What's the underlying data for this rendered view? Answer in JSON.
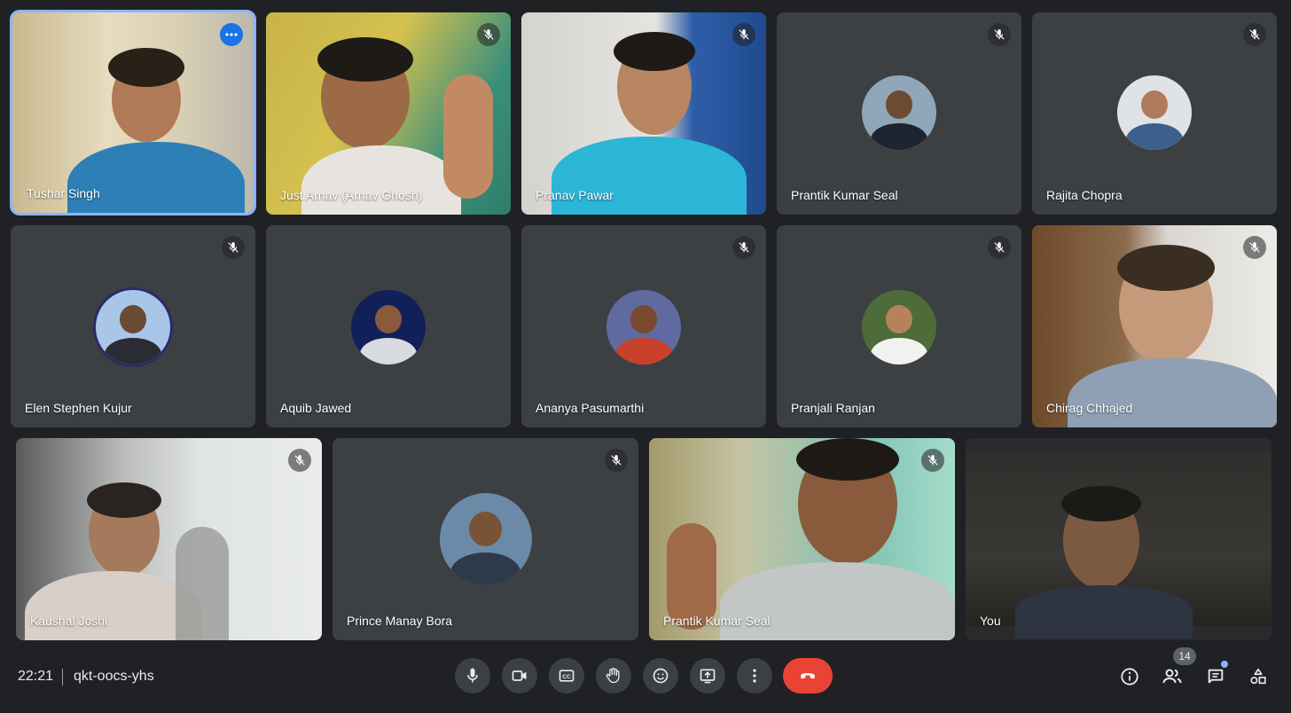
{
  "participants": [
    {
      "name": "Tushar Singh"
    },
    {
      "name": "Just Arnav (Arnav Ghosh)"
    },
    {
      "name": "Pranav Pawar"
    },
    {
      "name": "Prantik Kumar Seal"
    },
    {
      "name": "Rajita Chopra"
    },
    {
      "name": "Elen Stephen Kujur"
    },
    {
      "name": "Aquib Jawed"
    },
    {
      "name": "Ananya Pasumarthi"
    },
    {
      "name": "Pranjali Ranjan"
    },
    {
      "name": "Chirag Chhajed"
    },
    {
      "name": "Kaushal Joshi"
    },
    {
      "name": "Prince Manay Bora"
    },
    {
      "name": "Prantik Kumar Seal"
    },
    {
      "name": "You"
    }
  ],
  "bottom_bar": {
    "time": "22:21",
    "meeting_code": "qkt-oocs-yhs",
    "people_count": "14"
  },
  "colors": {
    "background": "#202124",
    "tile": "#3c4043",
    "active_border": "#8ab4f8",
    "end_call": "#ea4335",
    "more_button": "#1a73e8"
  },
  "icons": {
    "mic": "microphone-icon",
    "camera": "video-camera-icon",
    "captions": "closed-captions-icon",
    "hand": "raise-hand-icon",
    "emoji": "emoji-icon",
    "present": "present-screen-icon",
    "more": "more-vert-icon",
    "end": "call-end-icon",
    "info": "info-icon",
    "people": "people-icon",
    "chat": "chat-icon",
    "activities": "activities-icon",
    "muted": "mic-off-icon"
  }
}
